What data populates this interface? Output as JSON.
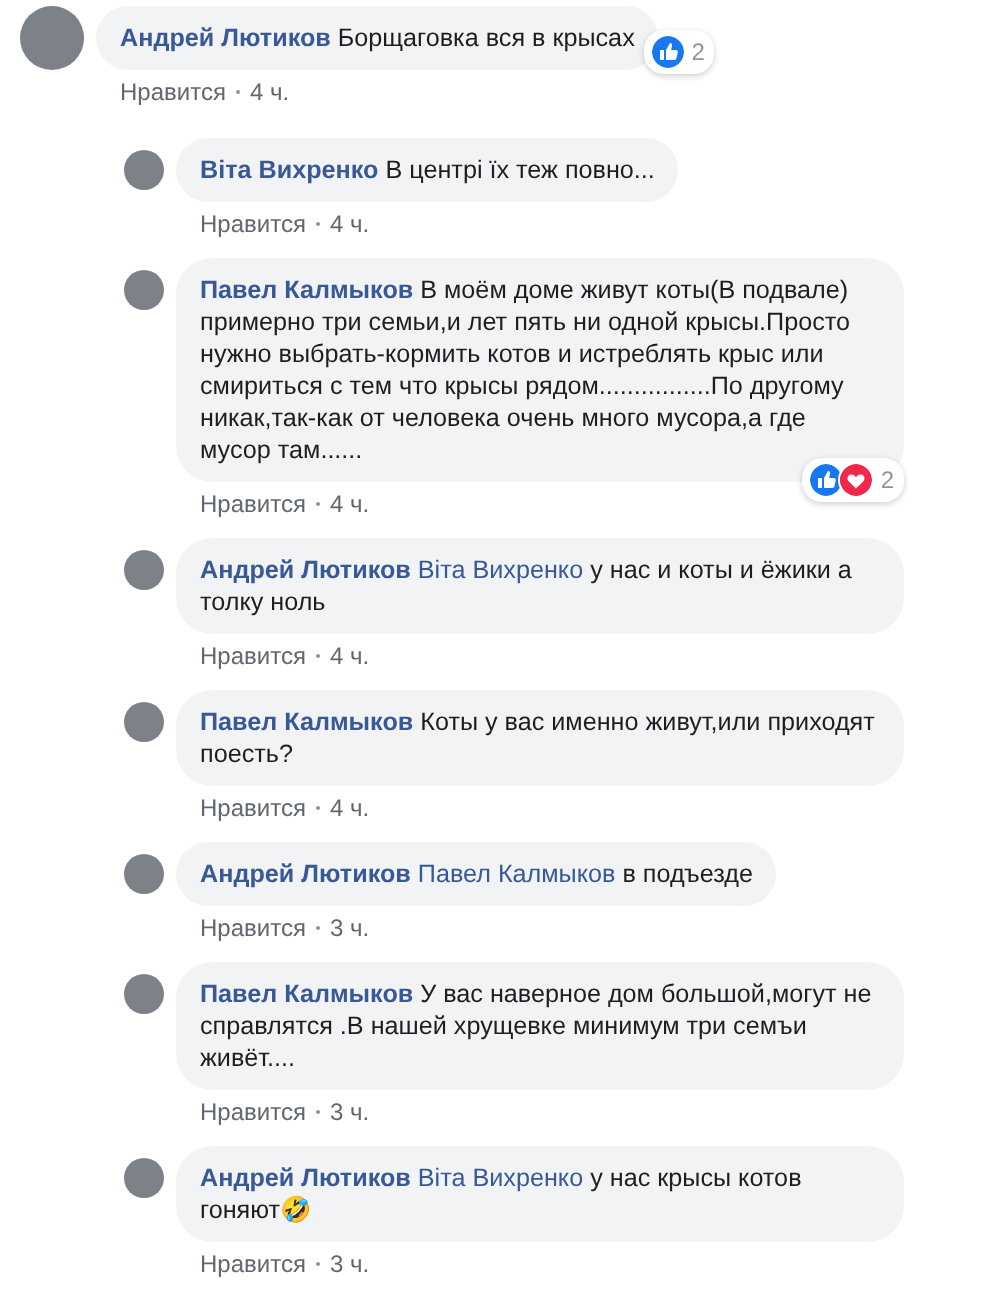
{
  "comments": [
    {
      "author": "Андрей Лютиков",
      "text": "Борщаговка вся в крысах",
      "like": "Нравится",
      "time": "4 ч.",
      "reactions": {
        "icons": [
          {
            "kind": "like"
          }
        ],
        "count": "2"
      },
      "replies": [
        {
          "author": "Віта Вихренко",
          "text": "В центрі їх теж повно...",
          "like": "Нравится",
          "time": "4 ч."
        },
        {
          "author": "Павел Калмыков",
          "text": "В моём доме живут коты(В подвале) примерно три семьи,и лет пять ни одной крысы.Просто нужно выбрать-кормить котов и истреблять крыс или смириться с тем что крысы рядом................По другому никак,так-как от человека очень много мусора,а где мусор там......",
          "like": "Нравится",
          "time": "4 ч.",
          "reactions": {
            "icons": [
              {
                "kind": "like"
              },
              {
                "kind": "love"
              }
            ],
            "count": "2"
          }
        },
        {
          "author": "Андрей Лютиков",
          "mention": "Віта Вихренко",
          "text": "у нас и коты и ёжики а толку ноль",
          "like": "Нравится",
          "time": "4 ч."
        },
        {
          "author": "Павел Калмыков",
          "text": "Коты у вас именно живут,или приходят поесть?",
          "like": "Нравится",
          "time": "4 ч."
        },
        {
          "author": "Андрей Лютиков",
          "mention": "Павел Калмыков",
          "text": "в подъезде",
          "like": "Нравится",
          "time": "3 ч."
        },
        {
          "author": "Павел Калмыков",
          "text": "У вас наверное дом большой,могут не справлятся .В нашей хрущевке минимум три семъи живёт....",
          "like": "Нравится",
          "time": "3 ч."
        },
        {
          "author": "Андрей Лютиков",
          "mention": "Віта Вихренко",
          "text": "у нас крысы котов гоняют🤣",
          "like": "Нравится",
          "time": "3 ч."
        }
      ]
    }
  ]
}
